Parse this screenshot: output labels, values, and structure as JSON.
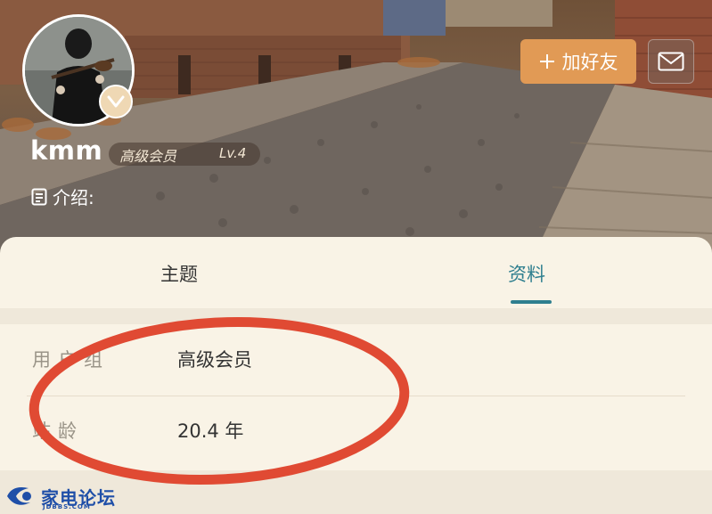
{
  "header": {
    "username": "kmm",
    "group": "高级会员",
    "level": "Lv.4",
    "intro_label": "介绍:",
    "add_friend_label": "加好友",
    "icons": [
      "plus-icon",
      "mail-icon",
      "intro-icon",
      "vip-badge-icon"
    ]
  },
  "tabs": [
    {
      "label": "主题",
      "active": false
    },
    {
      "label": "资料",
      "active": true
    }
  ],
  "profile": {
    "rows": [
      {
        "key": "用户组",
        "value": "高级会员"
      },
      {
        "key": "站龄",
        "value": "20.4 年"
      }
    ]
  },
  "watermark": {
    "brand": "家电论坛",
    "domain": "JDBBS.COM"
  },
  "colors": {
    "accent": "#2f7f8f",
    "add_friend_bg": "#e19a55",
    "annotation": "#e04a33",
    "watermark": "#1f4fa8"
  }
}
